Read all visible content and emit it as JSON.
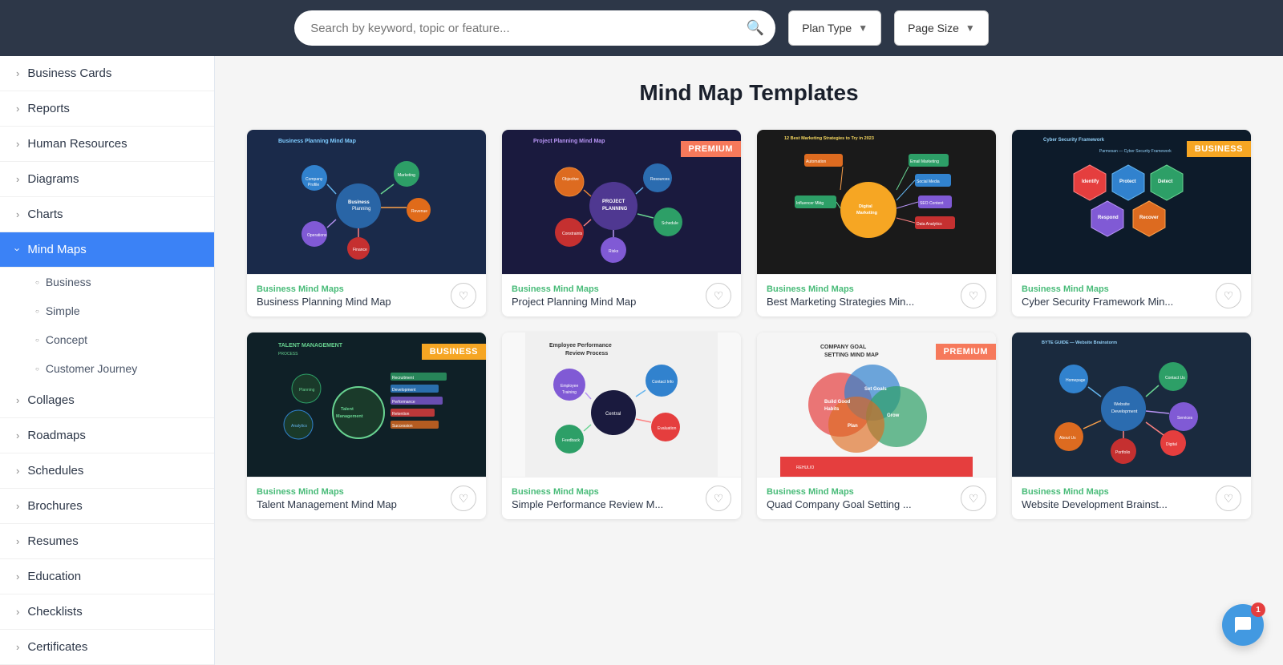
{
  "topbar": {
    "search_placeholder": "Search by keyword, topic or feature...",
    "plan_type_label": "Plan Type",
    "page_size_label": "Page Size"
  },
  "sidebar": {
    "items": [
      {
        "id": "business-cards",
        "label": "Business Cards",
        "active": false,
        "expanded": false
      },
      {
        "id": "reports",
        "label": "Reports",
        "active": false,
        "expanded": false
      },
      {
        "id": "human-resources",
        "label": "Human Resources",
        "active": false,
        "expanded": false
      },
      {
        "id": "diagrams",
        "label": "Diagrams",
        "active": false,
        "expanded": false
      },
      {
        "id": "charts",
        "label": "Charts",
        "active": false,
        "expanded": false
      },
      {
        "id": "mind-maps",
        "label": "Mind Maps",
        "active": true,
        "expanded": true
      },
      {
        "id": "collages",
        "label": "Collages",
        "active": false,
        "expanded": false
      },
      {
        "id": "roadmaps",
        "label": "Roadmaps",
        "active": false,
        "expanded": false
      },
      {
        "id": "schedules",
        "label": "Schedules",
        "active": false,
        "expanded": false
      },
      {
        "id": "brochures",
        "label": "Brochures",
        "active": false,
        "expanded": false
      },
      {
        "id": "resumes",
        "label": "Resumes",
        "active": false,
        "expanded": false
      },
      {
        "id": "education",
        "label": "Education",
        "active": false,
        "expanded": false
      },
      {
        "id": "checklists",
        "label": "Checklists",
        "active": false,
        "expanded": false
      },
      {
        "id": "certificates",
        "label": "Certificates",
        "active": false,
        "expanded": false
      }
    ],
    "sub_items": [
      {
        "label": "Business"
      },
      {
        "label": "Simple"
      },
      {
        "label": "Concept"
      },
      {
        "label": "Customer Journey"
      }
    ]
  },
  "content": {
    "page_title": "Mind Map Templates",
    "cards": [
      {
        "id": "card-1",
        "category": "Business Mind Maps",
        "name": "Business Planning Mind Map",
        "badge": null,
        "bg": "#1a2a4a"
      },
      {
        "id": "card-2",
        "category": "Business Mind Maps",
        "name": "Project Planning Mind Map",
        "badge": "PREMIUM",
        "badge_type": "premium",
        "bg": "#1a1a3e"
      },
      {
        "id": "card-3",
        "category": "Business Mind Maps",
        "name": "Best Marketing Strategies Min...",
        "badge": null,
        "bg": "#2d2d2d"
      },
      {
        "id": "card-4",
        "category": "Business Mind Maps",
        "name": "Cyber Security Framework Min...",
        "badge": "BUSINESS",
        "badge_type": "business",
        "bg": "#1a2744"
      },
      {
        "id": "card-5",
        "category": "Business Mind Maps",
        "name": "Talent Management Mind Map",
        "badge": "BUSINESS",
        "badge_type": "business",
        "bg": "#1a3a2a"
      },
      {
        "id": "card-6",
        "category": "Business Mind Maps",
        "name": "Simple Performance Review M...",
        "badge": null,
        "bg": "#2d1a4a"
      },
      {
        "id": "card-7",
        "category": "Business Mind Maps",
        "name": "Quad Company Goal Setting ...",
        "badge": "PREMIUM",
        "badge_type": "premium",
        "bg": "#1a3a3a"
      },
      {
        "id": "card-8",
        "category": "Business Mind Maps",
        "name": "Website Development Brainst...",
        "badge": null,
        "bg": "#1a2a3e"
      }
    ]
  },
  "chat": {
    "badge_count": "1"
  }
}
